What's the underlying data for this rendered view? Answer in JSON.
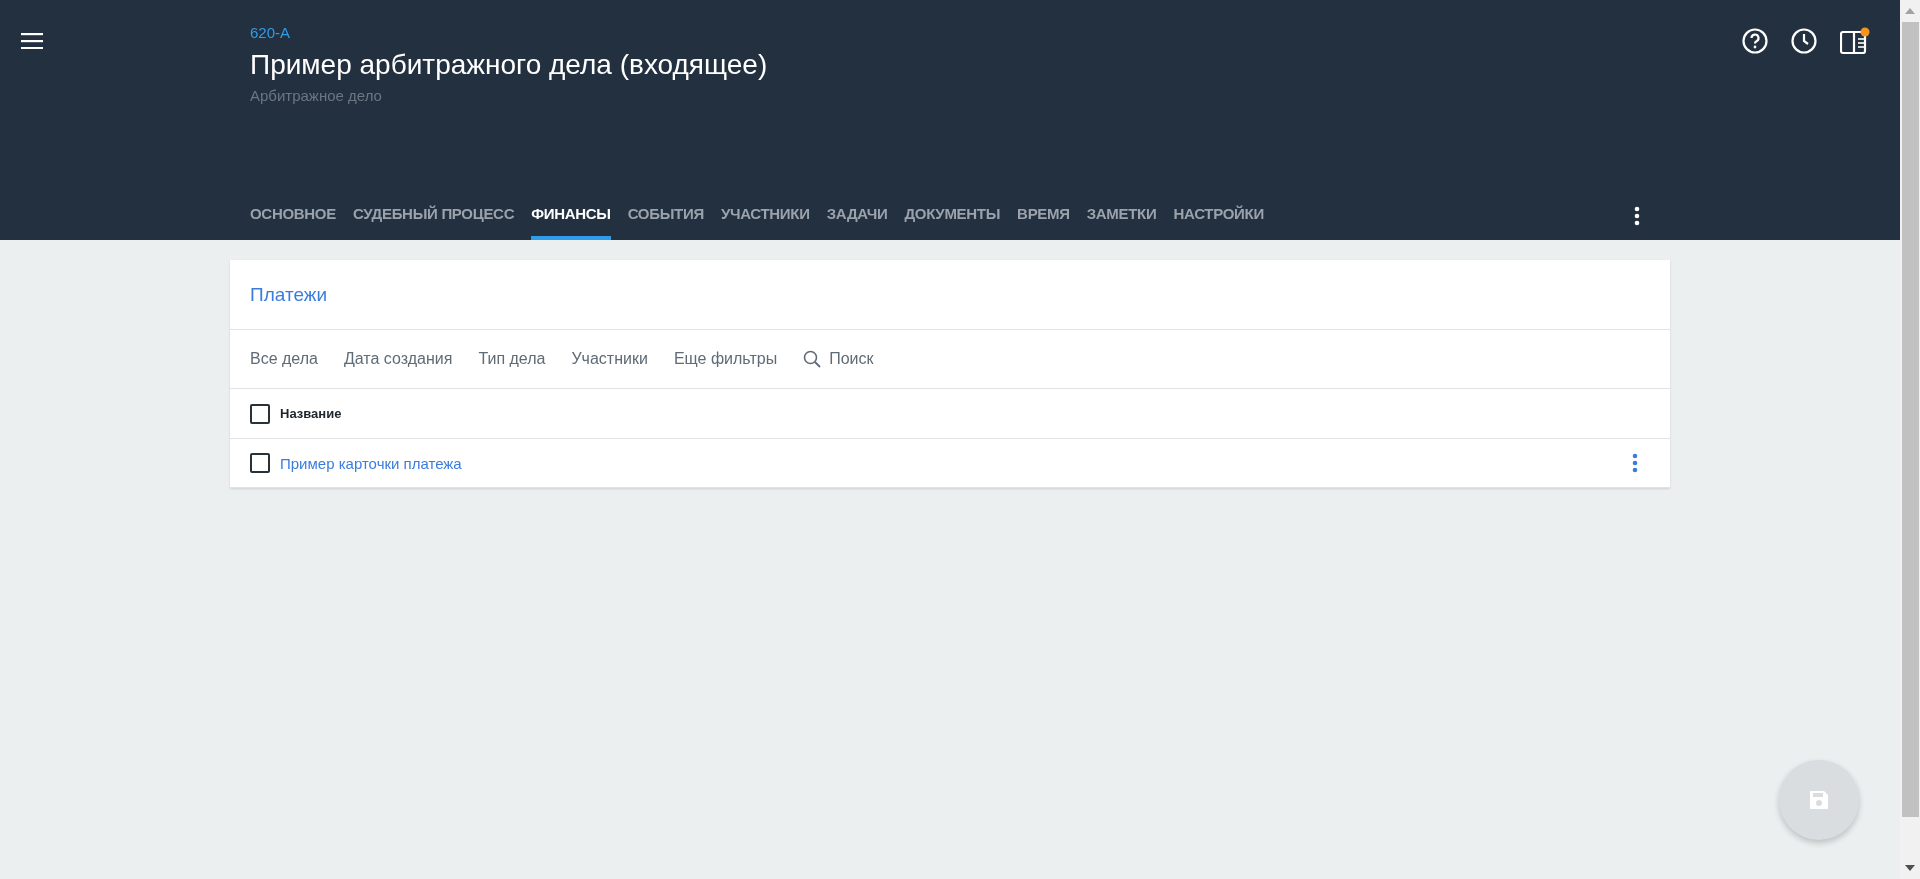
{
  "header": {
    "case_number": "620-A",
    "title": "Пример арбитражного дела (входящее)",
    "subtitle": "Арбитражное дело",
    "notification": true
  },
  "tabs": [
    {
      "label": "ОСНОВНОЕ",
      "selected": false
    },
    {
      "label": "СУДЕБНЫЙ ПРОЦЕСС",
      "selected": false
    },
    {
      "label": "ФИНАНСЫ",
      "selected": true
    },
    {
      "label": "СОБЫТИЯ",
      "selected": false
    },
    {
      "label": "УЧАСТНИКИ",
      "selected": false
    },
    {
      "label": "ЗАДАЧИ",
      "selected": false
    },
    {
      "label": "ДОКУМЕНТЫ",
      "selected": false
    },
    {
      "label": "ВРЕМЯ",
      "selected": false
    },
    {
      "label": "ЗАМЕТКИ",
      "selected": false
    },
    {
      "label": "НАСТРОЙКИ",
      "selected": false
    }
  ],
  "panel": {
    "title": "Платежи",
    "filters": [
      {
        "label": "Все дела",
        "kind": "filter"
      },
      {
        "label": "Дата создания",
        "kind": "filter"
      },
      {
        "label": "Тип дела",
        "kind": "filter"
      },
      {
        "label": "Участники",
        "kind": "filter"
      },
      {
        "label": "Еще фильтры",
        "kind": "filter"
      },
      {
        "label": "Поиск",
        "kind": "search"
      }
    ],
    "table": {
      "columns": [
        {
          "label": "Название",
          "checked": false
        }
      ],
      "rows": [
        {
          "name": "Пример карточки платежа",
          "checked": false
        }
      ]
    }
  },
  "save_button": {
    "disabled": true
  }
}
